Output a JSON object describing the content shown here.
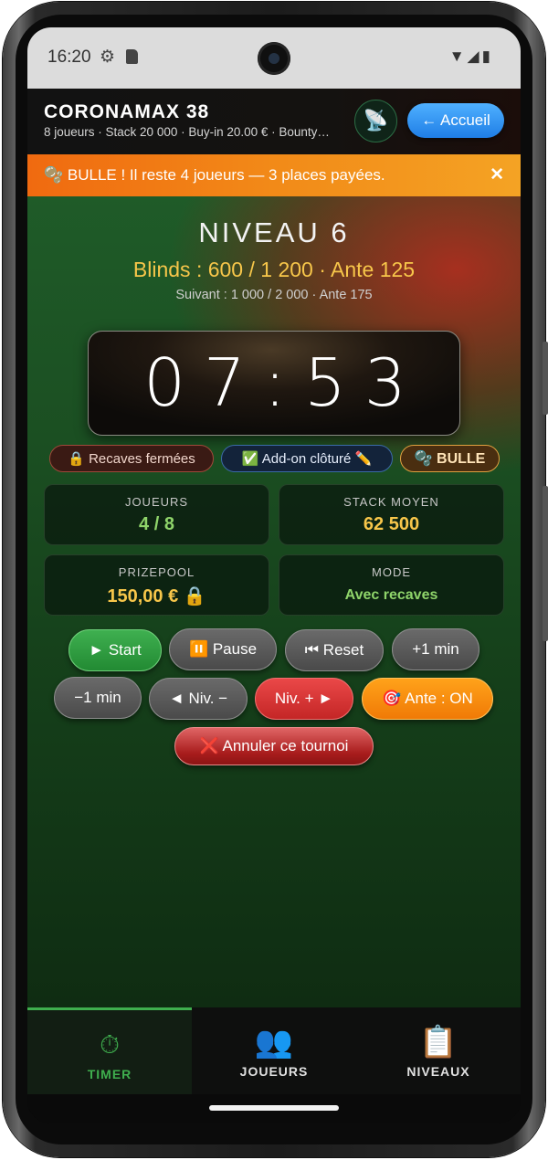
{
  "status_bar": {
    "time": "16:20",
    "gear_glyph": "⚙",
    "right_icons": "▼◢▮"
  },
  "header": {
    "title": "CORONAMAX 38",
    "subtitle": "8 joueurs · Stack 20 000 · Buy-in 20.00 € · Bounty…",
    "icon_button_glyph": "📡",
    "home_button_label": "← Accueil",
    "home_button_color": "#1f7ee6"
  },
  "banner": {
    "text": "🫧 BULLE ! Il reste 4 joueurs — 3 places payées.",
    "close_glyph": "✕",
    "color": "#f28a18"
  },
  "level": {
    "title": "NIVEAU 6",
    "blinds": "Blinds : 600 / 1 200 · Ante 125",
    "next": "Suivant : 1 000 / 2 000 · Ante 175"
  },
  "timer": {
    "value": "07:53"
  },
  "chips": {
    "recaves": "🔒 Recaves fermées",
    "addon": "✅ Add-on clôturé ✏️",
    "bulle": "🫧 BULLE"
  },
  "stats": {
    "players_label": "JOUEURS",
    "players_value": "4 / 8",
    "stack_label": "STACK MOYEN",
    "stack_value": "62 500",
    "prizepool_label": "PRIZEPOOL",
    "prizepool_value": "150,00 € 🔒",
    "mode_label": "MODE",
    "mode_value": "Avec recaves"
  },
  "controls": {
    "start": "► Start",
    "pause": "⏸️ Pause",
    "reset": "⏮ Reset",
    "plus_min": "+1 min",
    "minus_min": "−1 min",
    "prev_level": "◄ Niv. −",
    "next_level": "Niv. + ►",
    "ante": "🎯 Ante : ON",
    "cancel": "❌ Annuler ce tournoi"
  },
  "bottom_nav": {
    "tabs": [
      {
        "label": "TIMER",
        "icon": "⏱"
      },
      {
        "label": "JOUEURS",
        "icon": "👥"
      },
      {
        "label": "NIVEAUX",
        "icon": "📋"
      }
    ],
    "active_color": "#3fae4e"
  }
}
